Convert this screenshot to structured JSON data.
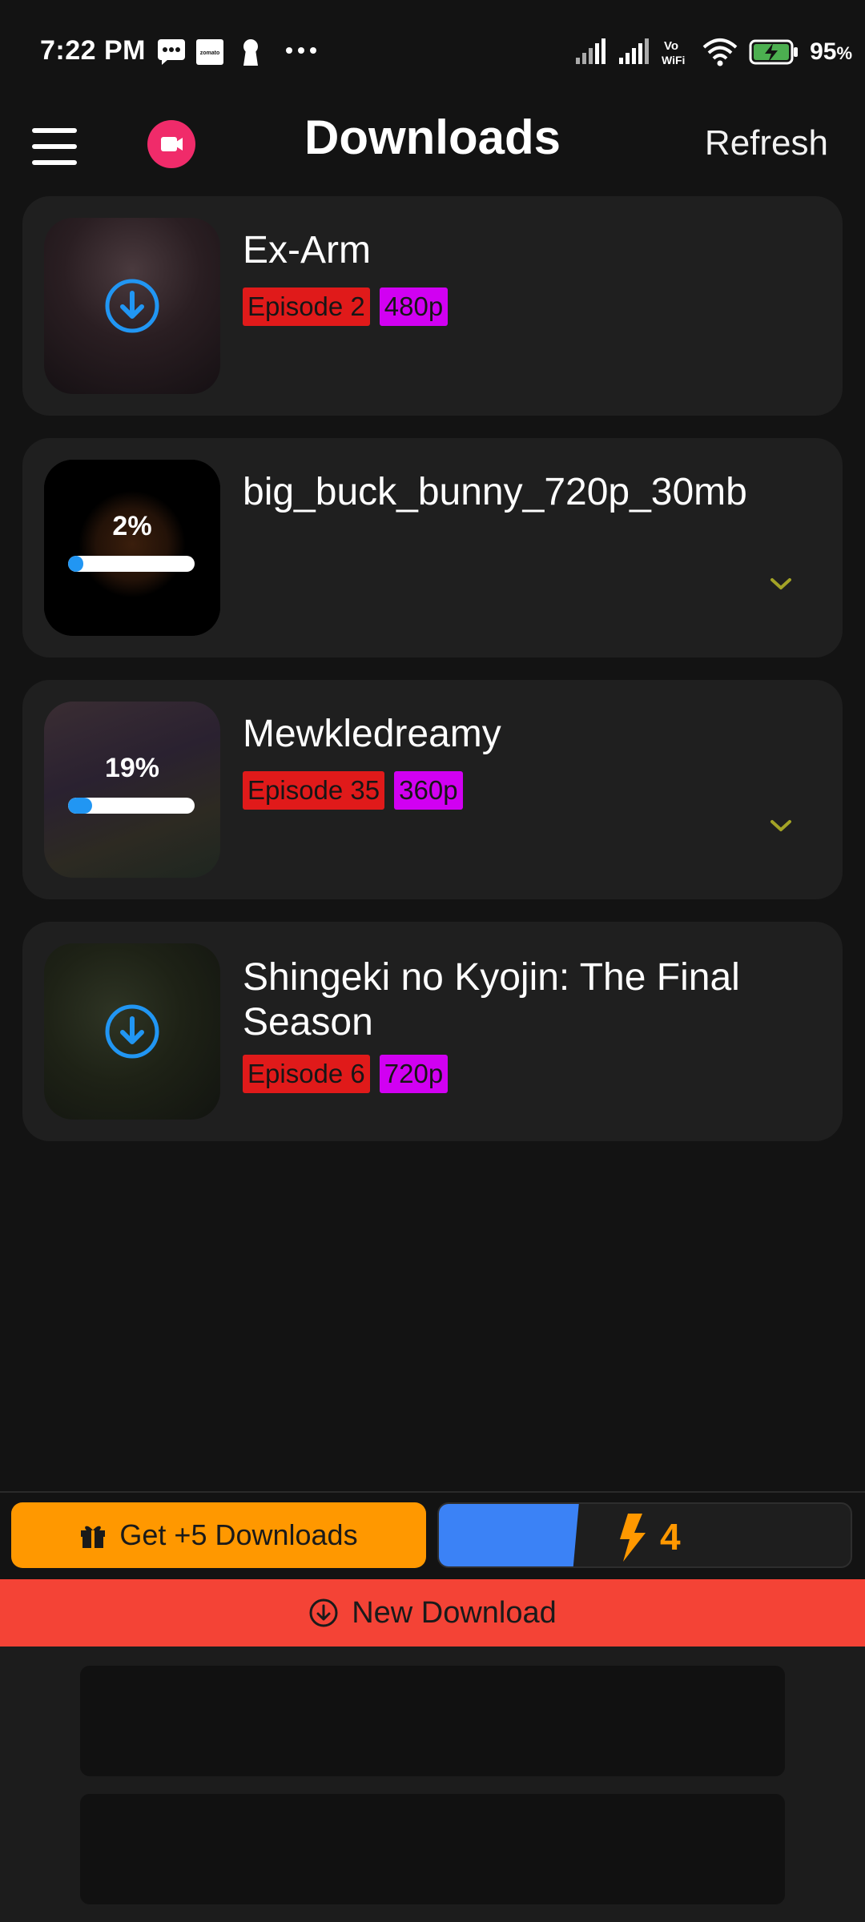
{
  "status_bar": {
    "time": "7:22 PM",
    "battery": "95",
    "battery_unit": "%",
    "icons": [
      "message-icon",
      "zomato-icon",
      "keyhole-icon",
      "more-dots-icon",
      "signal-icon",
      "signal-icon",
      "vowifi-icon",
      "wifi-icon",
      "battery-charging-icon"
    ],
    "vowifi_top": "Vo",
    "vowifi_bottom": "WiFi",
    "zomato_text": "zomato"
  },
  "header": {
    "title": "Downloads",
    "refresh_label": "Refresh",
    "menu_icon": "hamburger-menu-icon",
    "record_icon": "video-camera-icon"
  },
  "downloads": [
    {
      "title": "Ex-Arm",
      "episode": "Episode 2",
      "quality": "480p",
      "state": "queued"
    },
    {
      "title": "big_buck_bunny_720p_30mb",
      "progress_label": "2%",
      "progress": 0.02,
      "state": "downloading"
    },
    {
      "title": "Mewkledreamy",
      "episode": "Episode 35",
      "quality": "360p",
      "progress_label": "19%",
      "progress": 0.19,
      "state": "downloading"
    },
    {
      "title": "Shingeki no Kyojin: The Final Season",
      "episode": "Episode 6",
      "quality": "720p",
      "state": "queued"
    }
  ],
  "actions": {
    "get_downloads_label": "Get +5 Downloads",
    "credits_count": "4",
    "credits_level": 0.34,
    "new_download_label": "New Download"
  },
  "colors": {
    "background": "#131313",
    "card": "#1f1f1f",
    "episode_tag": "#e01a1a",
    "quality_tag": "#d100f2",
    "accent_blue": "#2196f3",
    "orange": "#ff9800",
    "red_bar": "#f44336",
    "record_pink": "#f02b6a",
    "chevron": "#a3a326"
  }
}
